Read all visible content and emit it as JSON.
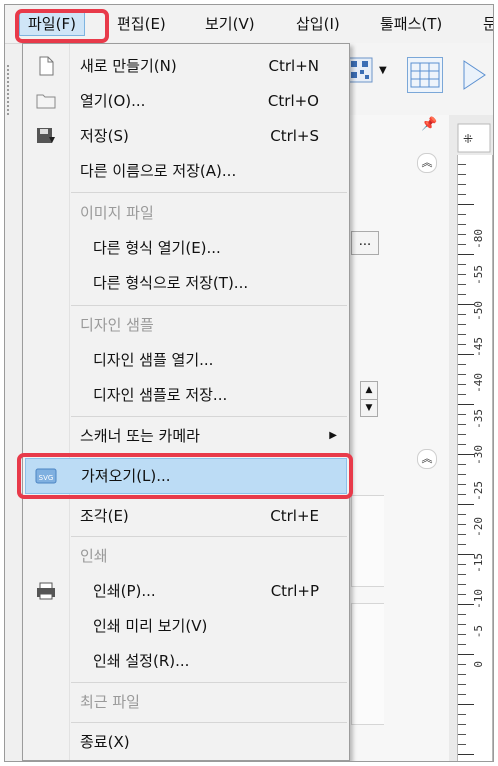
{
  "menubar": {
    "items": [
      {
        "label": "파일(F)"
      },
      {
        "label": "편집(E)"
      },
      {
        "label": "보기(V)"
      },
      {
        "label": "삽입(I)"
      },
      {
        "label": "툴패스(T)"
      }
    ]
  },
  "file_menu": {
    "items": [
      {
        "label": "새로 만들기(N)",
        "shortcut": "Ctrl+N",
        "icon": "new-file-icon"
      },
      {
        "label": "열기(O)...",
        "shortcut": "Ctrl+O",
        "icon": "folder-icon"
      },
      {
        "label": "저장(S)",
        "shortcut": "Ctrl+S",
        "icon": "save-icon"
      },
      {
        "label": "다른 이름으로 저장(A)..."
      },
      {
        "label": "이미지 파일",
        "disabled": true
      },
      {
        "label": "다른 형식 열기(E)..."
      },
      {
        "label": "다른 형식으로 저장(T)..."
      },
      {
        "label": "디자인 샘플",
        "disabled": true
      },
      {
        "label": "디자인 샘플 열기..."
      },
      {
        "label": "디자인 샘플로 저장..."
      },
      {
        "label": "스캐너 또는 카메라",
        "has_submenu": true
      },
      {
        "label": "가져오기(L)...",
        "icon": "svg-import-icon",
        "highlighted": true
      },
      {
        "label": "조각(E)",
        "shortcut": "Ctrl+E"
      },
      {
        "label": "인쇄",
        "disabled": true
      },
      {
        "label": "인쇄(P)...",
        "shortcut": "Ctrl+P",
        "icon": "printer-icon"
      },
      {
        "label": "인쇄 미리 보기(V)"
      },
      {
        "label": "인쇄 설정(R)..."
      },
      {
        "label": "최근 파일",
        "disabled": true
      },
      {
        "label": "종료(X)"
      }
    ]
  },
  "svg_icon_text": "SVG",
  "ruler": {
    "labels": [
      "-80",
      "-55",
      "-50",
      "-45",
      "-40",
      "-35",
      "-30",
      "-25",
      "-20",
      "-15",
      "-10",
      "-5",
      "0"
    ]
  },
  "colors": {
    "highlight_box": "#e83a4a",
    "menu_hover": "#bcdcf5",
    "menubar_active": "#cfe5f7"
  }
}
